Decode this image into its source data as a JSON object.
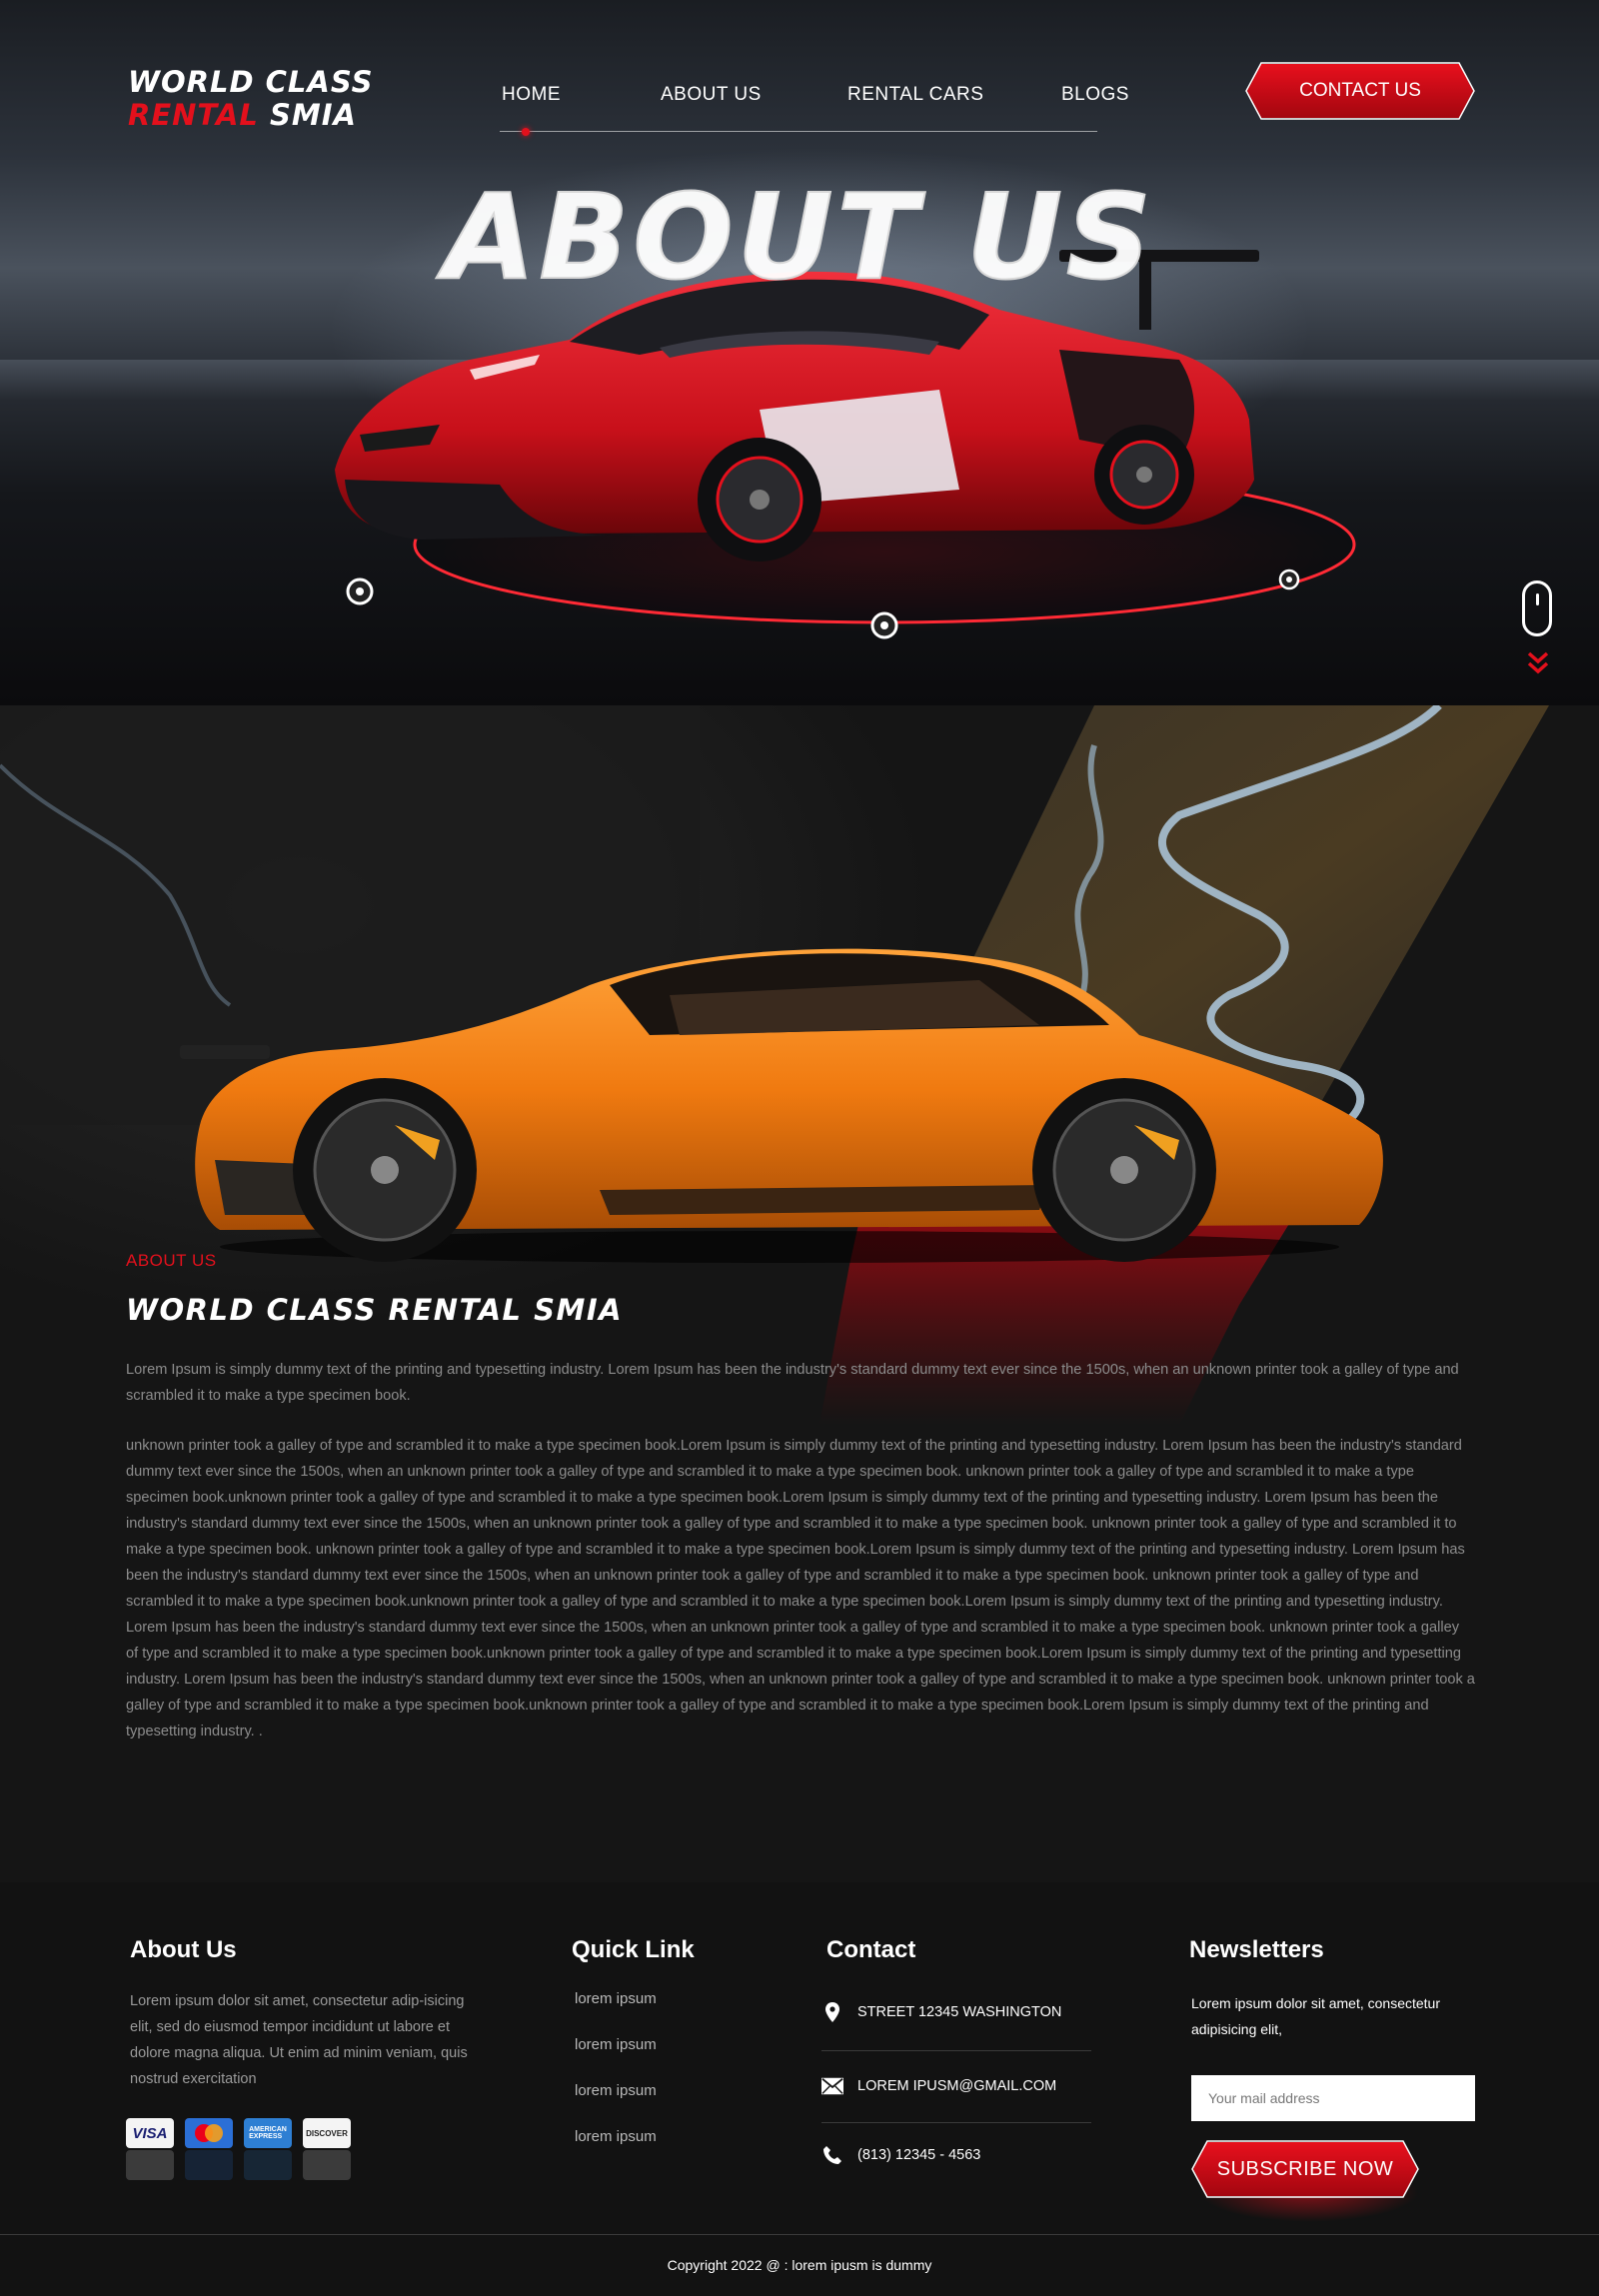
{
  "colors": {
    "accent": "#e3101c",
    "background": "#151515",
    "footer": "#121212",
    "car_orange": "#f07a10"
  },
  "brand": {
    "line1": "WORLD CLASS",
    "line2_red": "RENTAL",
    "line2_white": "SMIA"
  },
  "nav": {
    "items": [
      {
        "label": "HOME",
        "active": true
      },
      {
        "label": "ABOUT US"
      },
      {
        "label": "RENTAL CARS"
      },
      {
        "label": "BLOGS"
      }
    ],
    "contact_label": "CONTACT US"
  },
  "hero": {
    "title": "ABOUT US"
  },
  "about": {
    "label": "ABOUT US",
    "title": "WORLD CLASS RENTAL SMIA",
    "p1": "Lorem Ipsum is simply dummy text of the printing and typesetting industry. Lorem Ipsum has been the industry's standard dummy text ever since the 1500s, when an unknown printer took a galley of type and scrambled it to make a type specimen book.",
    "p2": "unknown printer took a galley of type and scrambled it to make a type specimen book.Lorem Ipsum is simply dummy text of the printing and typesetting industry. Lorem Ipsum has been the industry's standard dummy text ever since the 1500s, when an unknown printer took a galley of type and scrambled it to make a type specimen book. unknown printer took a galley of type and scrambled it to make a type specimen book.unknown printer took a galley of type and scrambled it to make a type specimen book.Lorem Ipsum is simply dummy text of the printing and typesetting industry. Lorem Ipsum has been the industry's standard dummy text ever since the 1500s, when an unknown printer took a galley of type and scrambled it to make a type specimen book. unknown printer took a galley of type and scrambled it to make a type specimen book. unknown printer took a galley of type and scrambled it to make a type specimen book.Lorem Ipsum is simply dummy text of the printing and typesetting industry. Lorem Ipsum has been the industry's standard dummy text ever since the 1500s, when an unknown printer took a galley of type and scrambled it to make a type specimen book. unknown printer took a galley of type and scrambled it to make a type specimen book.unknown printer took a galley of type and scrambled it to make a type specimen book.Lorem Ipsum is simply dummy text of the printing and typesetting industry. Lorem Ipsum has been the industry's standard dummy text ever since the 1500s, when an unknown printer took a galley of type and scrambled it to make a type specimen book. unknown printer took a galley of type and scrambled it to make a type specimen book.unknown printer took a galley of type and scrambled it to make a type specimen book.Lorem Ipsum is simply dummy text of the printing and typesetting industry. Lorem Ipsum has been the industry's standard dummy text ever since the 1500s, when an unknown printer took a galley of type and scrambled it to make a type specimen book. unknown printer took a galley of type and scrambled it to make a type specimen book.unknown printer took a galley of type and scrambled it to make a type specimen book.Lorem Ipsum is simply dummy text of the printing and typesetting industry. ."
  },
  "footer": {
    "about": {
      "heading": "About Us",
      "text": "Lorem ipsum dolor sit amet, consectetur adip-isicing elit, sed do eiusmod tempor incididunt ut labore et dolore magna aliqua. Ut enim ad minim veniam, quis nostrud exercitation",
      "cards": [
        {
          "label": "VISA",
          "icon": "visa-card-icon"
        },
        {
          "label": "MasterCard",
          "icon": "mastercard-icon"
        },
        {
          "label": "AMERICAN EXPRESS",
          "icon": "amex-card-icon"
        },
        {
          "label": "DISCOVER",
          "icon": "discover-card-icon"
        }
      ]
    },
    "quick": {
      "heading": "Quick Link",
      "links": [
        "lorem ipsum",
        "lorem ipsum",
        "lorem ipsum",
        "lorem ipsum"
      ]
    },
    "contact": {
      "heading": "Contact",
      "address": "STREET 12345 WASHINGTON",
      "email": "LOREM IPUSM@GMAIL.COM",
      "phone": "(813) 12345 - 4563",
      "icons": [
        "location-pin-icon",
        "envelope-icon",
        "phone-icon"
      ]
    },
    "newsletter": {
      "heading": "Newsletters",
      "text": "Lorem ipsum dolor sit amet, consectetur adipisicing elit,",
      "placeholder": "Your mail address",
      "button": "SUBSCRIBE NOW"
    },
    "copyright": "Copyright 2022  @ : lorem ipusm is dummy"
  }
}
